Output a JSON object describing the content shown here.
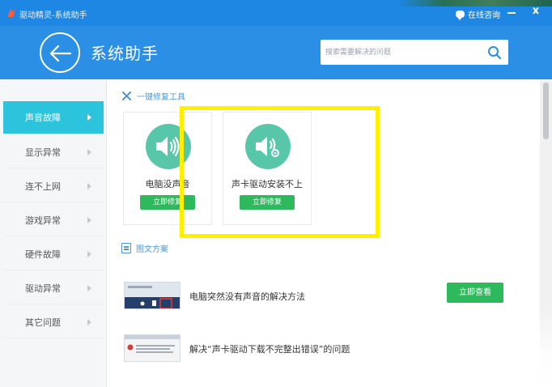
{
  "window": {
    "app_title": "驱动精灵-系统助手",
    "consult_label": "在线咨询",
    "close_glyph": "x"
  },
  "header": {
    "page_title": "系统助手",
    "search_placeholder": "搜索需要解决的问题"
  },
  "sidebar": {
    "items": [
      {
        "label": "声音故障",
        "active": true
      },
      {
        "label": "显示异常",
        "active": false
      },
      {
        "label": "连不上网",
        "active": false
      },
      {
        "label": "游戏异常",
        "active": false
      },
      {
        "label": "硬件故障",
        "active": false
      },
      {
        "label": "驱动异常",
        "active": false
      },
      {
        "label": "其它问题",
        "active": false
      }
    ]
  },
  "repair": {
    "section_title": "一键修复工具",
    "cards": [
      {
        "label": "电脑没声音",
        "button": "立即修复",
        "icon": "speaker-icon"
      },
      {
        "label": "声卡驱动安装不上",
        "button": "立即修复",
        "icon": "speaker-gear-icon"
      }
    ]
  },
  "articles": {
    "section_title": "图文方案",
    "items": [
      {
        "title": "电脑突然没有声音的解决方法",
        "button": "立即查看"
      },
      {
        "title": "解决“声卡驱动下载不完整出错误”的问题",
        "button": ""
      }
    ]
  },
  "colors": {
    "title_bar": "#1e86e3",
    "header": "#2b8fe6",
    "sidebar_active": "#2cc4dd",
    "green_button": "#2eb95c",
    "speaker_circle": "#58c6a9",
    "highlight": "#fff000"
  }
}
